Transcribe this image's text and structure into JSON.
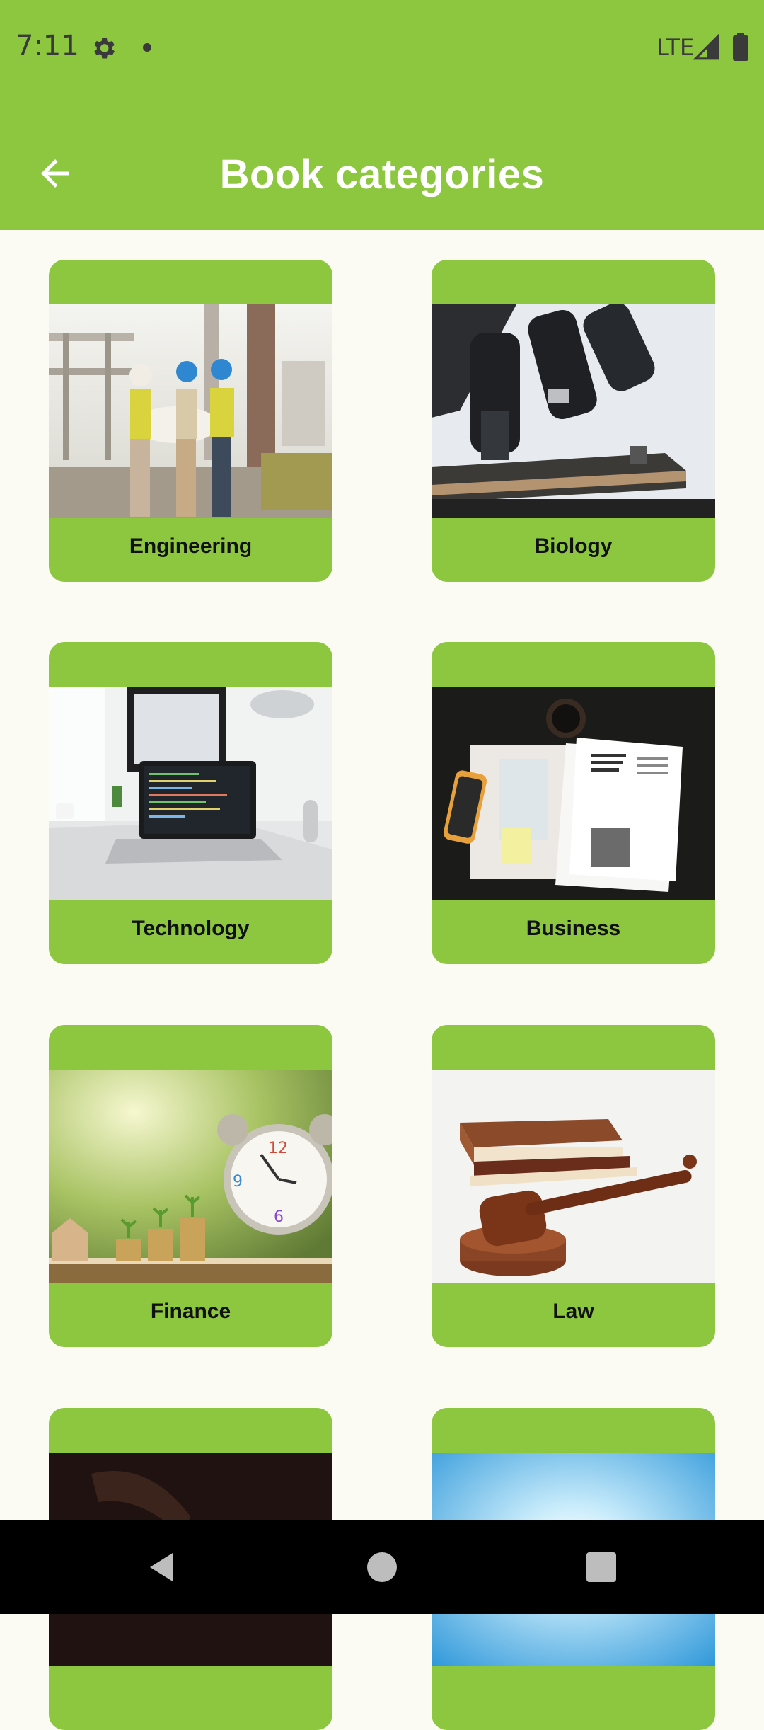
{
  "status_bar": {
    "time": "7:11",
    "network": "LTE",
    "icons": [
      "settings-gear-icon",
      "notification-dot-icon",
      "signal-icon",
      "battery-icon"
    ]
  },
  "app_bar": {
    "title": "Book categories",
    "back_icon": "arrow-left-icon"
  },
  "categories": [
    {
      "label": "Engineering",
      "image": "engineers-with-blueprint-photo"
    },
    {
      "label": "Biology",
      "image": "microscope-photo"
    },
    {
      "label": "Technology",
      "image": "laptop-on-desk-photo"
    },
    {
      "label": "Business",
      "image": "tax-forms-and-calculator-photo"
    },
    {
      "label": "Finance",
      "image": "alarm-clock-and-coins-photo"
    },
    {
      "label": "Law",
      "image": "gavel-and-books-photo"
    },
    {
      "label": "",
      "image": "dark-hand-photo"
    },
    {
      "label": "",
      "image": "bright-sky-photo"
    }
  ],
  "colors": {
    "accent": "#8dc63f",
    "background": "#fbfbf4",
    "title_text": "#ffffff",
    "label_text": "#111111"
  },
  "nav_bar": {
    "icons": [
      "nav-back-icon",
      "nav-home-icon",
      "nav-recents-icon"
    ]
  }
}
